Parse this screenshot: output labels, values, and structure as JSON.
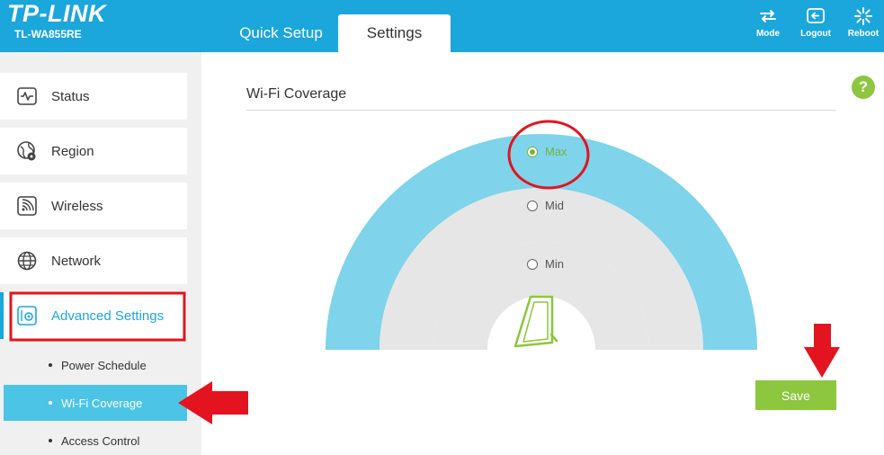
{
  "header": {
    "brand": "TP-LINK",
    "model": "TL-WA855RE",
    "tabs": [
      {
        "label": "Quick Setup",
        "active": false
      },
      {
        "label": "Settings",
        "active": true
      }
    ],
    "buttons": [
      {
        "label": "Mode",
        "icon": "mode-icon"
      },
      {
        "label": "Logout",
        "icon": "logout-icon"
      },
      {
        "label": "Reboot",
        "icon": "reboot-icon"
      }
    ],
    "bg_color": "#1ba6dc"
  },
  "sidebar": {
    "items": [
      {
        "label": "Status",
        "icon": "status-icon"
      },
      {
        "label": "Region",
        "icon": "region-icon"
      },
      {
        "label": "Wireless",
        "icon": "wireless-icon"
      },
      {
        "label": "Network",
        "icon": "network-icon"
      },
      {
        "label": "Advanced Settings",
        "icon": "advanced-settings-icon",
        "active": true
      }
    ],
    "sub_items": [
      {
        "label": "Power Schedule",
        "selected": false
      },
      {
        "label": "Wi-Fi Coverage",
        "selected": true
      },
      {
        "label": "Access Control",
        "selected": false
      }
    ]
  },
  "main": {
    "title": "Wi-Fi Coverage",
    "coverage_options": [
      {
        "label": "Max",
        "checked": true
      },
      {
        "label": "Mid",
        "checked": false
      },
      {
        "label": "Min",
        "checked": false
      }
    ],
    "save_label": "Save",
    "help_icon": "help-icon",
    "help_label": "?"
  },
  "colors": {
    "accent": "#1ba6dc",
    "green": "#8dc63f",
    "arc_max": "#7fd3ea",
    "arc_other": "#e6e6e6",
    "annotation_red": "#e3141f"
  }
}
